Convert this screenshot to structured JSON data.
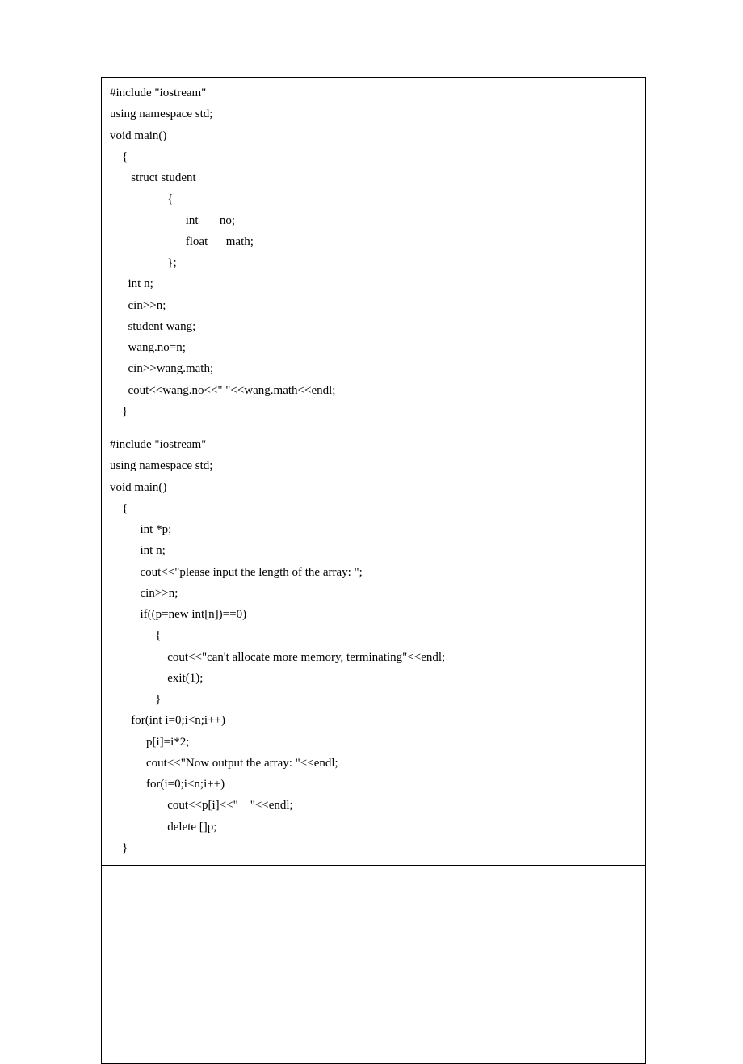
{
  "cell1": {
    "lines": [
      "#include \"iostream\"",
      "using namespace std;",
      "void main()",
      "    {",
      "       struct student",
      "                   {",
      "                         int       no;",
      "                         float      math;",
      "                   };",
      "      int n;",
      "      cin>>n;",
      "      student wang;",
      "      wang.no=n;",
      "      cin>>wang.math;",
      "      cout<<wang.no<<\" \"<<wang.math<<endl;",
      "    }"
    ]
  },
  "cell2": {
    "lines": [
      "#include \"iostream\"",
      "using namespace std;",
      "void main()",
      "    {",
      "          int *p;",
      "          int n;",
      "          cout<<\"please input the length of the array: \";",
      "          cin>>n;",
      "          if((p=new int[n])==0)",
      "               {",
      "                   cout<<\"can't allocate more memory, terminating\"<<endl;",
      "                   exit(1);",
      "               }",
      "       for(int i=0;i<n;i++)",
      "            p[i]=i*2;",
      "            cout<<\"Now output the array: \"<<endl;",
      "            for(i=0;i<n;i++)",
      "                   cout<<p[i]<<\"    \"<<endl;",
      "                   delete []p;",
      "    }"
    ]
  }
}
